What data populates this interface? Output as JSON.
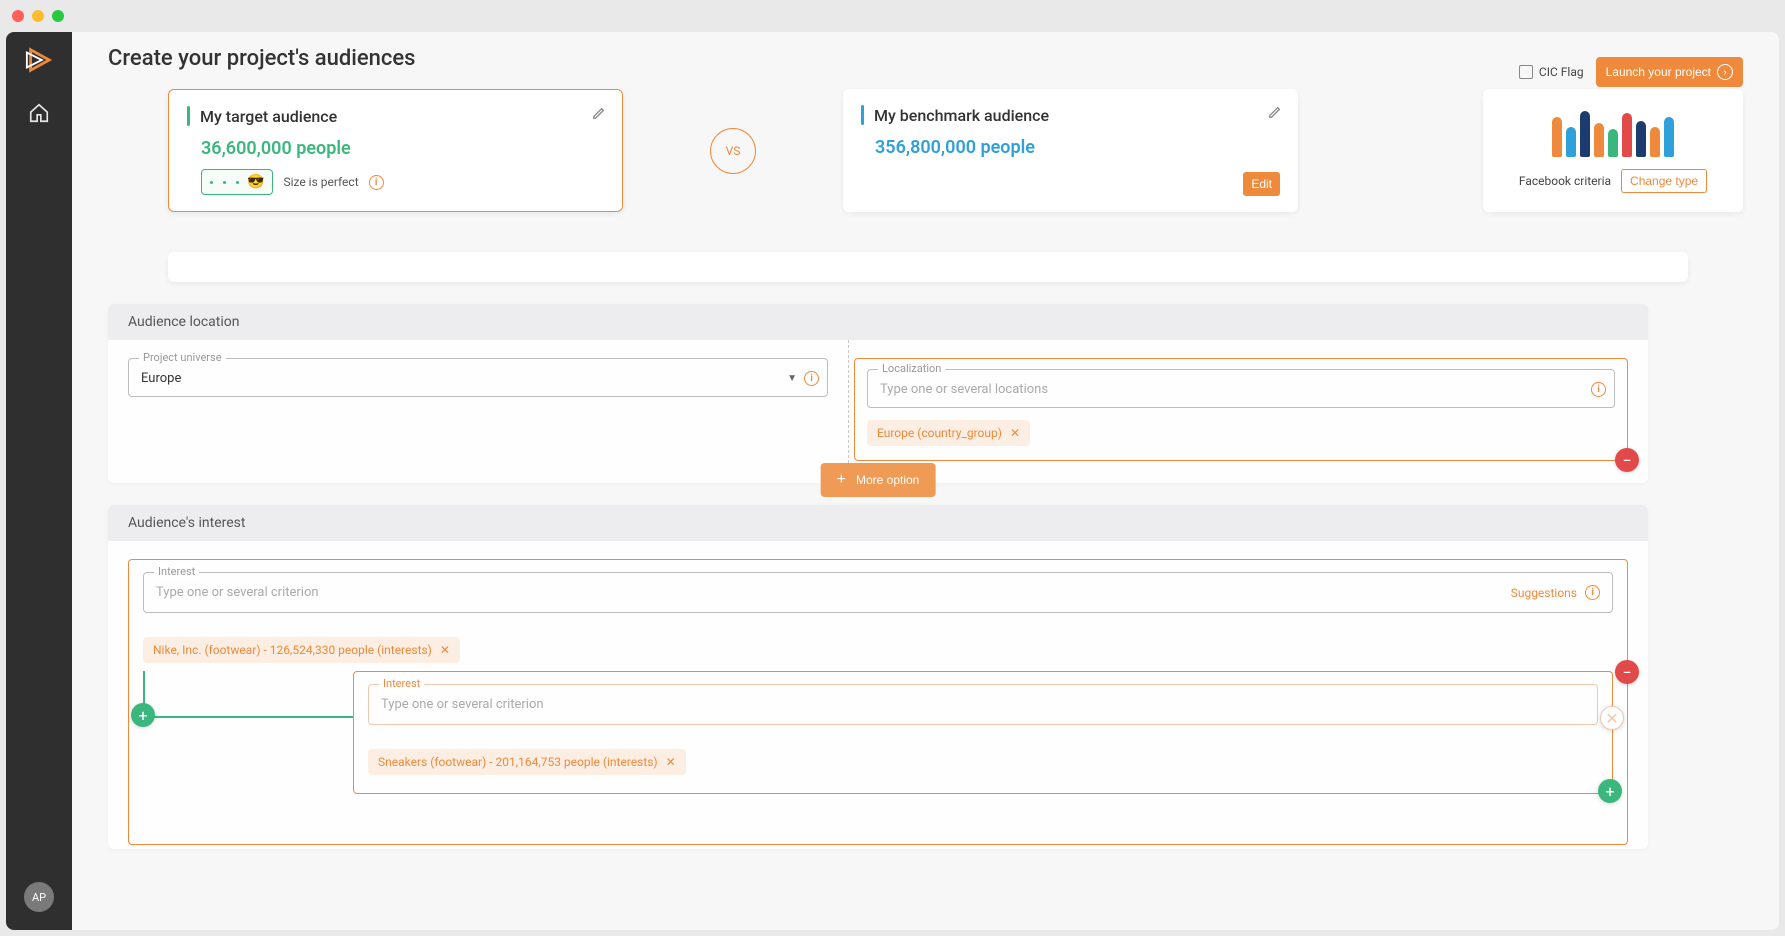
{
  "window": {
    "title": "Create your project's audiences"
  },
  "sidebar": {
    "avatar_initials": "AP"
  },
  "topbar": {
    "cic_label": "CIC Flag",
    "launch_label": "Launch your project"
  },
  "target_card": {
    "title": "My target audience",
    "people": "36,600,000 people",
    "size_text": "Size is perfect",
    "emoji": "😎"
  },
  "vs_label": "VS",
  "benchmark_card": {
    "title": "My benchmark audience",
    "people": "356,800,000 people",
    "edit_label": "Edit"
  },
  "type_card": {
    "criteria_label": "Facebook criteria",
    "change_label": "Change type"
  },
  "location_section": {
    "title": "Audience location",
    "universe_label": "Project universe",
    "universe_value": "Europe",
    "localization_label": "Localization",
    "localization_placeholder": "Type one or several locations",
    "chip": "Europe (country_group)",
    "more_option": "More option"
  },
  "interest_section": {
    "title": "Audience's interest",
    "interest_label": "Interest",
    "interest_placeholder": "Type one or several criterion",
    "suggestions_label": "Suggestions",
    "chip1": "Nike, Inc. (footwear) - 126,524,330 people (interests)",
    "sub_interest_label": "Interest",
    "sub_placeholder": "Type one or several criterion",
    "chip2": "Sneakers (footwear) - 201,164,753 people (interests)"
  }
}
